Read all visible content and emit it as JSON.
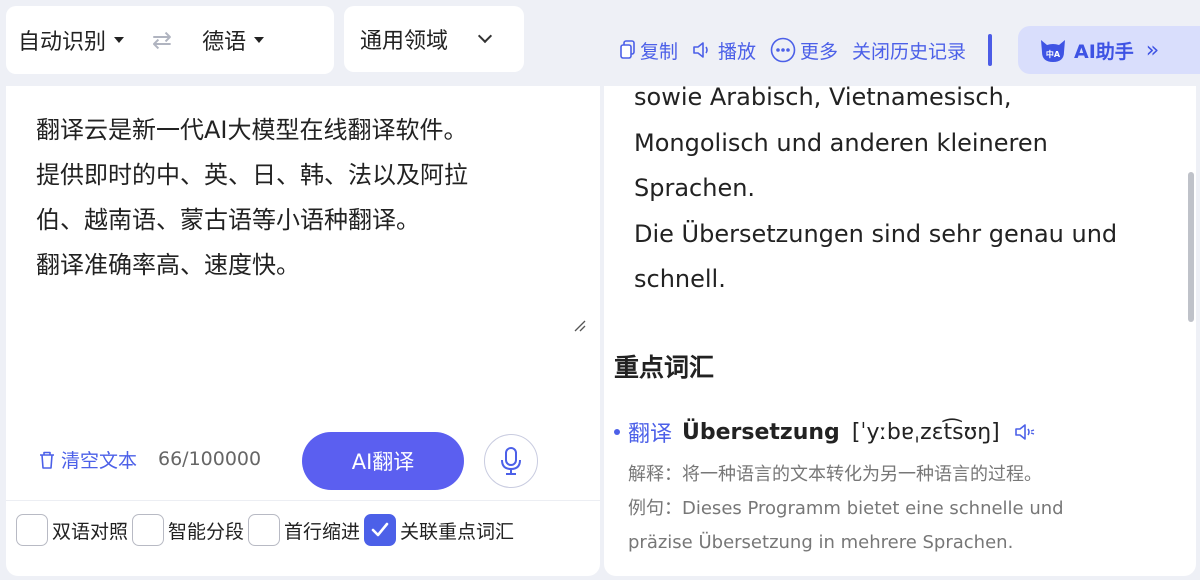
{
  "lang": {
    "source": "自动识别",
    "target": "德语",
    "swap_icon": "⇄"
  },
  "domain": {
    "label": "通用领域"
  },
  "toolbar": {
    "copy": "复制",
    "play": "播放",
    "more": "更多",
    "close_history": "关闭历史记录",
    "ai_helper": "AI助手",
    "ai_helper_icon_text": "中A"
  },
  "source": {
    "text": "翻译云是新一代AI大模型在线翻译软件。\n提供即时的中、英、日、韩、法以及阿拉\n伯、越南语、蒙古语等小语种翻译。\n翻译准确率高、速度快。",
    "clear_label": "清空文本",
    "count": "66/100000",
    "translate_button": "AI翻译"
  },
  "options": [
    {
      "label": "双语对照",
      "checked": false
    },
    {
      "label": "智能分段",
      "checked": false
    },
    {
      "label": "首行缩进",
      "checked": false
    },
    {
      "label": "关联重点词汇",
      "checked": true
    }
  ],
  "translation": {
    "text": "sowie Arabisch, Vietnamesisch,\nMongolisch und anderen kleineren\nSprachen.\nDie Übersetzungen sind sehr genau und\nschnell."
  },
  "vocab": {
    "title": "重点词汇",
    "items": [
      {
        "zh": "翻译",
        "de": "Übersetzung",
        "phonetic": "[ˈyːbɐˌzɛt͡sʊŋ]",
        "explain": "解释：将一种语言的文本转化为另一种语言的过程。",
        "example_line1": "例句：Dieses Programm bietet eine schnelle und",
        "example_line2": "präzise Übersetzung in mehrere Sprachen."
      }
    ]
  },
  "colors": {
    "accent": "#4c60e8",
    "button": "#5b5ff0",
    "background": "#eef0f6"
  }
}
